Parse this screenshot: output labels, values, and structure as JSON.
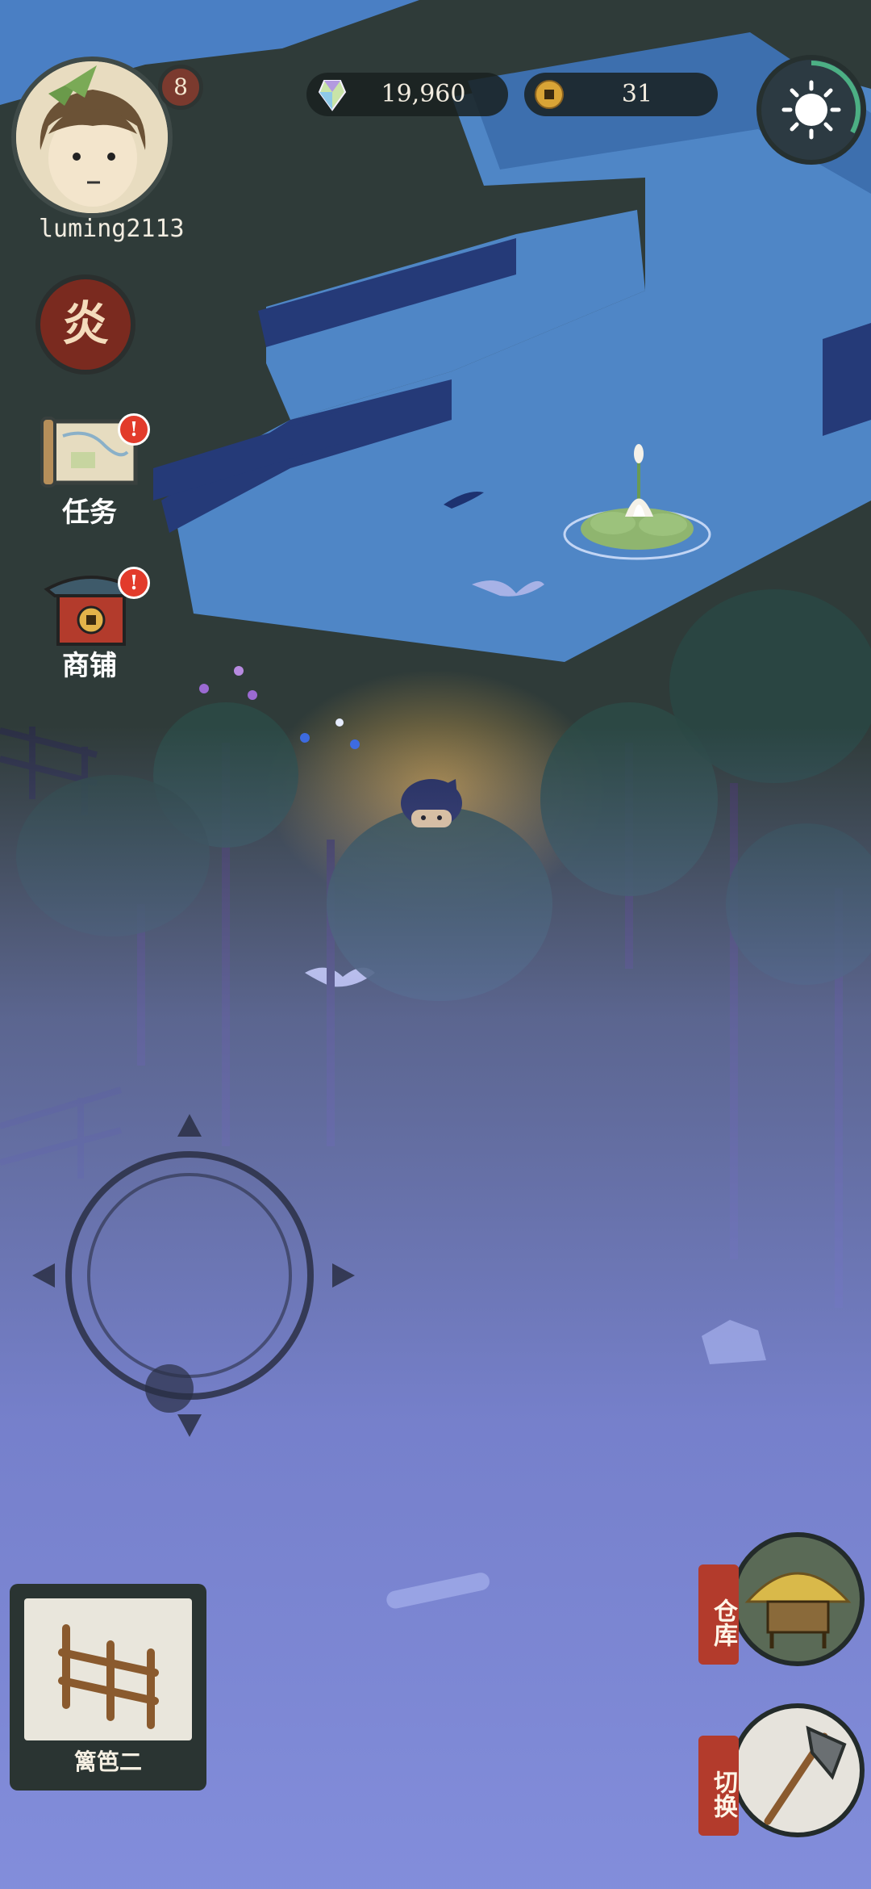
{
  "player": {
    "username": "luming2113",
    "level": "8"
  },
  "resources": {
    "gems": "19,960",
    "coins": "31"
  },
  "side_menu": {
    "element_badge": "炎",
    "quest_label": "任务",
    "quest_alert": "!",
    "shop_label": "商铺",
    "shop_alert": "!"
  },
  "item_slot": {
    "label": "篱笆二"
  },
  "actions": {
    "storage_label": "仓库",
    "switch_label": "切换"
  },
  "icons": {
    "gem": "gem-icon",
    "coin": "coin-icon",
    "settings": "sun-gear-icon",
    "quest": "scroll-map-icon",
    "shop": "shop-building-icon",
    "fence": "fence-icon",
    "storage": "straw-hut-icon",
    "switch": "axe-icon"
  },
  "colors": {
    "water": "#4f86c6",
    "fog": "#7f88d6",
    "grass": "#2c3a38",
    "accent_red": "#b33b2c"
  }
}
